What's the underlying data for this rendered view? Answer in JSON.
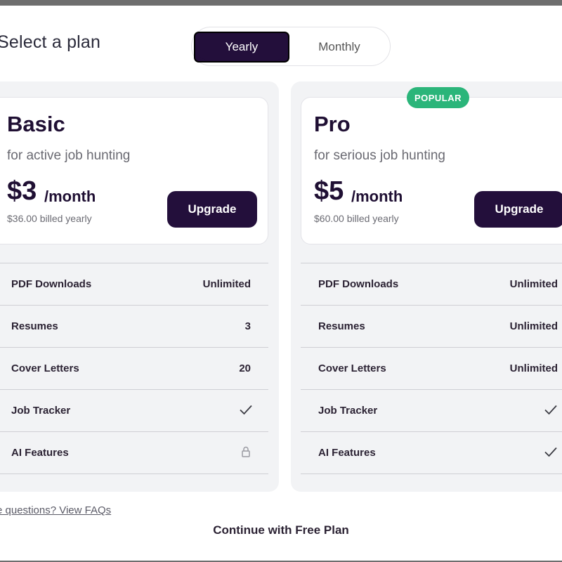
{
  "title": "Select a plan",
  "billing_toggle": {
    "options": [
      "Yearly",
      "Monthly"
    ],
    "selected": "Yearly"
  },
  "plans": {
    "basic": {
      "name": "Basic",
      "subtitle": "for active job hunting",
      "price": "$3",
      "per": "/month",
      "billed": "$36.00 billed yearly",
      "button": "Upgrade",
      "features": [
        {
          "name": "PDF Downloads",
          "value": "Unlimited"
        },
        {
          "name": "Resumes",
          "value": "3"
        },
        {
          "name": "Cover Letters",
          "value": "20"
        },
        {
          "name": "Job Tracker",
          "value": "",
          "icon": "check-icon"
        },
        {
          "name": "AI Features",
          "value": "",
          "icon": "lock-icon"
        }
      ]
    },
    "pro": {
      "badge": "POPULAR",
      "name": "Pro",
      "subtitle": "for serious job hunting",
      "price": "$5",
      "per": "/month",
      "billed": "$60.00 billed yearly",
      "button": "Upgrade",
      "features": [
        {
          "name": "PDF Downloads",
          "value": "Unlimited"
        },
        {
          "name": "Resumes",
          "value": "Unlimited"
        },
        {
          "name": "Cover Letters",
          "value": "Unlimited"
        },
        {
          "name": "Job Tracker",
          "value": "",
          "icon": "check-icon"
        },
        {
          "name": "AI Features",
          "value": "",
          "icon": "check-icon"
        }
      ]
    }
  },
  "faq_link": "re questions? View FAQs",
  "free_plan_link": "Continue with Free Plan",
  "colors": {
    "primary": "#230f3b",
    "badge": "#2bb57a",
    "card_bg": "#f2f3f5"
  }
}
